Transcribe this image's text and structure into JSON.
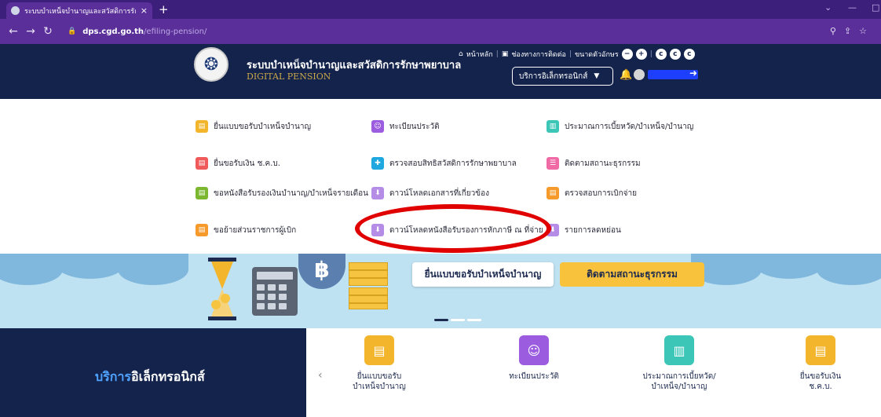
{
  "browser": {
    "tab_title": "ระบบบำเหน็จบำนาญและสวัสดิการรักษ",
    "tab_close": "×",
    "new_tab": "+",
    "url_host": "dps.cgd.go.th",
    "url_path": "/efiling-pension/"
  },
  "header": {
    "site_name": "ระบบบำเหน็จบำนาญและสวัสดิการรักษาพยาบาล",
    "site_sub": "DIGITAL PENSION",
    "link_home": "หน้าหลัก",
    "link_contact": "ช่องทางการติดต่อ",
    "link_fontsize": "ขนาดตัวอักษร",
    "eservice_label": "บริการอิเล็กทรอนิกส์"
  },
  "menu": {
    "col1": [
      {
        "label": "ยื่นแบบขอรับบำเหน็จบำนาญ",
        "color": "yellow"
      },
      {
        "label": "ยื่นขอรับเงิน ช.ค.บ.",
        "color": "red"
      },
      {
        "label": "ขอหนังสือรับรองเงินบำนาญ/บำเหน็จรายเดือน",
        "color": "green"
      },
      {
        "label": "ขอย้ายส่วนราชการผู้เบิก",
        "color": "orange"
      }
    ],
    "col2": [
      {
        "label": "ทะเบียนประวัติ",
        "color": "purple"
      },
      {
        "label": "ตรวจสอบสิทธิสวัสดิการรักษาพยาบาล",
        "color": "blue"
      },
      {
        "label": "ดาวน์โหลดเอกสารที่เกี่ยวข้อง",
        "color": "lav"
      },
      {
        "label": "ดาวน์โหลดหนังสือรับรองการหักภาษี ณ ที่จ่าย",
        "color": "lav"
      }
    ],
    "col3": [
      {
        "label": "ประมาณการเบี้ยหวัด/บำเหน็จ/บำนาญ",
        "color": "teal"
      },
      {
        "label": "ติดตามสถานะธุรกรรม",
        "color": "pink"
      },
      {
        "label": "ตรวจสอบการเบิกจ่าย",
        "color": "orange"
      },
      {
        "label": "รายการลดหย่อน",
        "color": "lav"
      }
    ]
  },
  "banner": {
    "btn_submit": "ยื่นแบบขอรับบำเหน็จบำนาญ",
    "btn_track": "ติดตามสถานะธุรกรรม",
    "baht_symbol": "฿"
  },
  "eservice": {
    "title_a": "บริการ",
    "title_b": "อิเล็กทรอนิกส์",
    "prev": "‹",
    "items": [
      {
        "label1": "ยื่นแบบขอรับ",
        "label2": "บำเหน็จบำนาญ",
        "color": "yellow"
      },
      {
        "label1": "ทะเบียนประวัติ",
        "label2": "",
        "color": "purple"
      },
      {
        "label1": "ประมาณการเบี้ยหวัด/",
        "label2": "บำเหน็จ/บำนาญ",
        "color": "teal"
      },
      {
        "label1": "ยื่นขอรับเงิน",
        "label2": "ช.ค.บ.",
        "color": "yellow"
      }
    ]
  }
}
